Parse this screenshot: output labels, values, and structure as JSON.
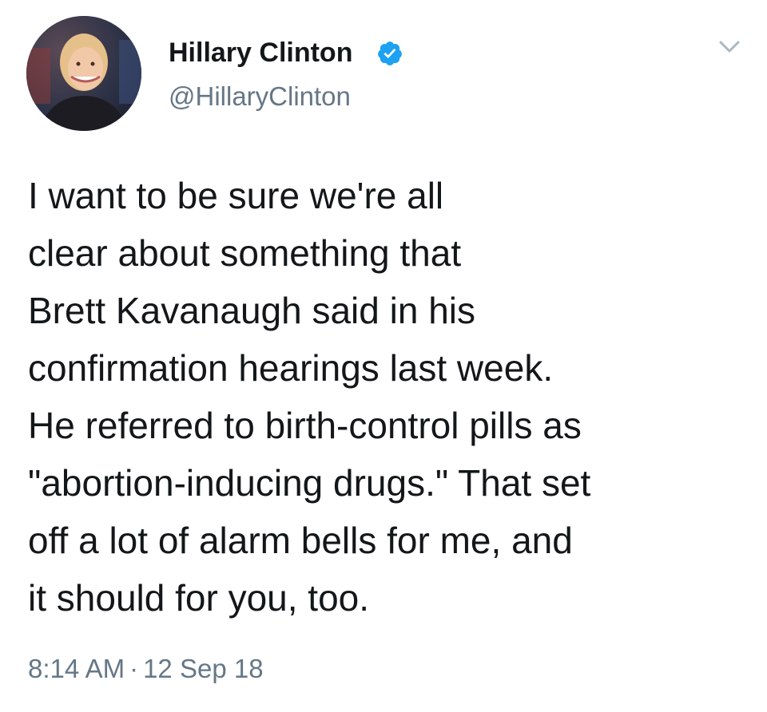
{
  "tweet": {
    "author": {
      "name": "Hillary Clinton",
      "handle": "@HillaryClinton",
      "verified": true,
      "verified_color": "#1da1f2"
    },
    "menu_icon": "chevron-down-icon",
    "text": "I want to be sure we're all\nclear about something that\nBrett Kavanaugh said in his\nconfirmation hearings last week.\nHe referred to birth-control pills as\n\"abortion-inducing drugs.\" That set\noff a lot of alarm bells for me, and\nit should for you, too.",
    "time": "8:14 AM",
    "separator": "·",
    "date": "12 Sep 18"
  }
}
